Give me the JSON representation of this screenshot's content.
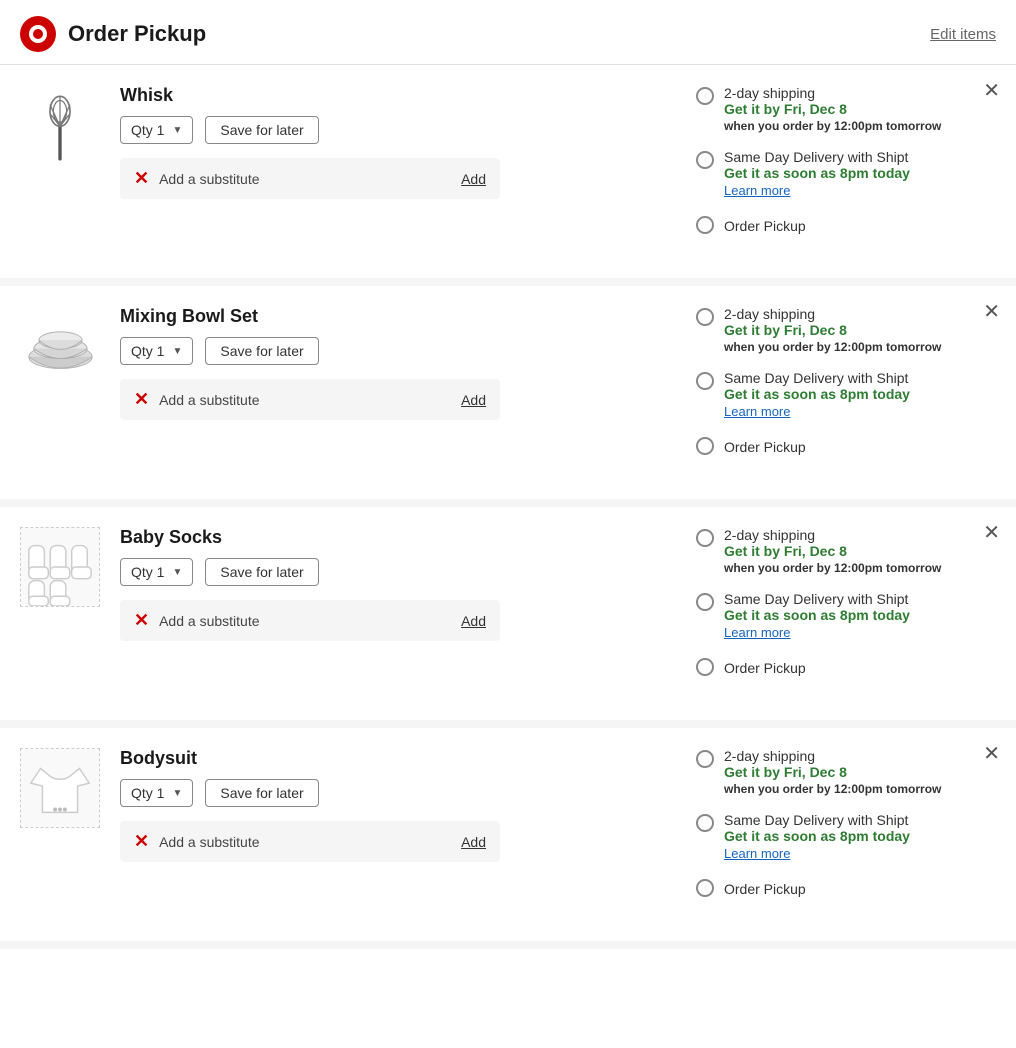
{
  "header": {
    "logo_symbol": "🎯",
    "title": "Order Pickup",
    "edit_items_label": "Edit items"
  },
  "items": [
    {
      "id": "whisk",
      "name": "Whisk",
      "qty_label": "Qty 1",
      "save_for_later_label": "Save for later",
      "substitute_label": "Add a substitute",
      "add_label": "Add",
      "delivery_options": [
        {
          "type": "2day",
          "label": "2-day shipping",
          "date": "Get it by Fri, Dec 8",
          "note": "when you order by 12:00pm tomorrow",
          "selected": false
        },
        {
          "type": "shipt",
          "label": "Same Day Delivery with Shipt",
          "date": "Get it as soon as 8pm today",
          "learn_more": "Learn more",
          "selected": false
        },
        {
          "type": "pickup",
          "label": "Order Pickup",
          "selected": false
        }
      ]
    },
    {
      "id": "mixing-bowl-set",
      "name": "Mixing Bowl Set",
      "qty_label": "Qty 1",
      "save_for_later_label": "Save for later",
      "substitute_label": "Add a substitute",
      "add_label": "Add",
      "delivery_options": [
        {
          "type": "2day",
          "label": "2-day shipping",
          "date": "Get it by Fri, Dec 8",
          "note": "when you order by 12:00pm tomorrow",
          "selected": false
        },
        {
          "type": "shipt",
          "label": "Same Day Delivery with Shipt",
          "date": "Get it as soon as 8pm today",
          "learn_more": "Learn more",
          "selected": false
        },
        {
          "type": "pickup",
          "label": "Order Pickup",
          "selected": false
        }
      ]
    },
    {
      "id": "baby-socks",
      "name": "Baby Socks",
      "qty_label": "Qty 1",
      "save_for_later_label": "Save for later",
      "substitute_label": "Add a substitute",
      "add_label": "Add",
      "delivery_options": [
        {
          "type": "2day",
          "label": "2-day shipping",
          "date": "Get it by Fri, Dec 8",
          "note": "when you order by 12:00pm tomorrow",
          "selected": false
        },
        {
          "type": "shipt",
          "label": "Same Day Delivery with Shipt",
          "date": "Get it as soon as 8pm today",
          "learn_more": "Learn more",
          "selected": false
        },
        {
          "type": "pickup",
          "label": "Order Pickup",
          "selected": false
        }
      ]
    },
    {
      "id": "bodysuit",
      "name": "Bodysuit",
      "qty_label": "Qty 1",
      "save_for_later_label": "Save for later",
      "substitute_label": "Add a substitute",
      "add_label": "Add",
      "delivery_options": [
        {
          "type": "2day",
          "label": "2-day shipping",
          "date": "Get it by Fri, Dec 8",
          "note": "when you order by 12:00pm tomorrow",
          "selected": false
        },
        {
          "type": "shipt",
          "label": "Same Day Delivery with Shipt",
          "date": "Get it as soon as 8pm today",
          "learn_more": "Learn more",
          "selected": false
        },
        {
          "type": "pickup",
          "label": "Order Pickup",
          "selected": false
        }
      ]
    }
  ]
}
